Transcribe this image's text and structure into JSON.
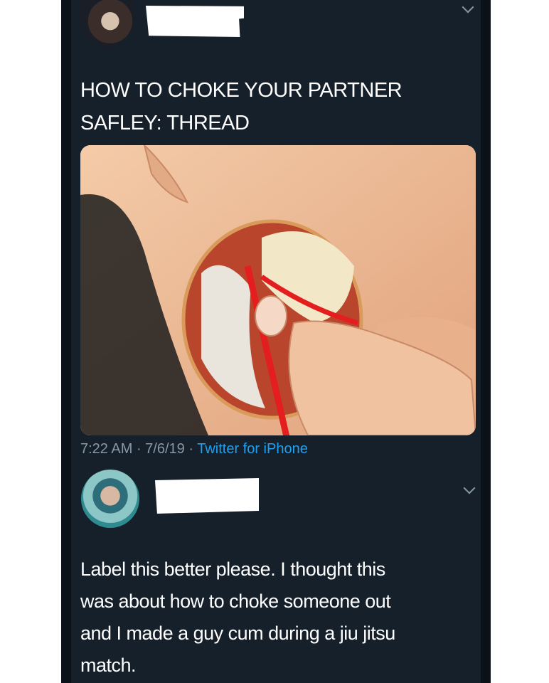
{
  "tweet": {
    "text_lines": [
      "HOW TO CHOKE YOUR PARTNER",
      "SAFLEY: THREAD"
    ],
    "time": "7:22 AM",
    "date": "7/6/19",
    "separator": " · ",
    "source": "Twitter for iPhone",
    "media_icon": "neck-anatomy-illustration"
  },
  "reply": {
    "text_lines": [
      "Label this better please. I thought this",
      "was about how to choke someone out",
      "and I made a guy cum during a jiu jitsu",
      "match."
    ]
  },
  "colors": {
    "background": "#15202b",
    "text": "#ffffff",
    "meta": "#8899a6",
    "link": "#1da1f2"
  }
}
